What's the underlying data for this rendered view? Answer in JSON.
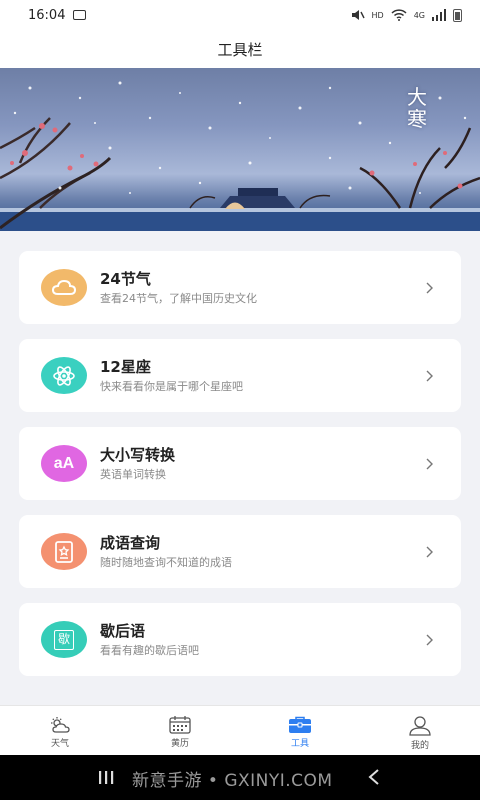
{
  "status_bar": {
    "time": "16:04",
    "hd": "HD",
    "net": "4G"
  },
  "header": {
    "title": "工具栏"
  },
  "banner": {
    "text": "大寒"
  },
  "tools": [
    {
      "title": "24节气",
      "subtitle": "查看24节气，了解中国历史文化",
      "icon": "cloud-icon",
      "color": "#f2b96a"
    },
    {
      "title": "12星座",
      "subtitle": "快来看看你是属于哪个星座吧",
      "icon": "atom-icon",
      "color": "#3ad0c0"
    },
    {
      "title": "大小写转换",
      "subtitle": "英语单词转换",
      "icon": "case-convert-icon",
      "color": "#e067e2",
      "icon_text": "aA"
    },
    {
      "title": "成语查询",
      "subtitle": "随时随地查询不知道的成语",
      "icon": "idiom-book-icon",
      "color": "#f49170"
    },
    {
      "title": "歇后语",
      "subtitle": "看看有趣的歇后语吧",
      "icon": "proverb-book-icon",
      "color": "#35cdb8",
      "icon_text": "歇"
    }
  ],
  "bottom_nav": [
    {
      "label": "天气",
      "icon": "weather-icon"
    },
    {
      "label": "黄历",
      "icon": "calendar-icon"
    },
    {
      "label": "工具",
      "icon": "toolbox-icon",
      "active": true
    },
    {
      "label": "我的",
      "icon": "profile-icon"
    }
  ],
  "system_nav": {
    "watermark": "新意手游 • GXINYI.COM"
  },
  "colors": {
    "accent": "#2d7ef0",
    "background": "#f1f2f6"
  }
}
